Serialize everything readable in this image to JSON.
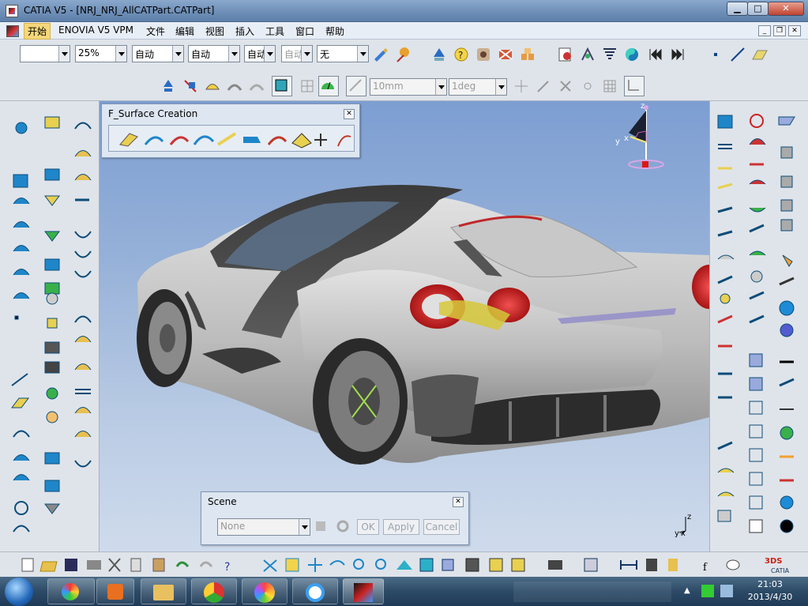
{
  "window": {
    "title": "CATIA V5 - [NRJ_NRJ_AllCATPart.CATPart]",
    "min_label": "▁",
    "max_label": "□",
    "close_label": "✕"
  },
  "menu": {
    "items": [
      "开始",
      "ENOVIA V5 VPM",
      "文件",
      "编辑",
      "视图",
      "插入",
      "工具",
      "窗口",
      "帮助"
    ]
  },
  "toolbar": {
    "combos": [
      "",
      "25%",
      "自动",
      "自动",
      "自动",
      "自动",
      "无"
    ],
    "length_value": "10mm",
    "angle_value": "1deg"
  },
  "surface_panel": {
    "title": "F_Surface Creation",
    "close": "✕"
  },
  "scene_panel": {
    "title": "Scene",
    "close": "✕",
    "select_value": "None",
    "ok": "OK",
    "apply": "Apply",
    "cancel": "Cancel"
  },
  "compass": {
    "x": "x",
    "y": "y",
    "z": "z"
  },
  "axis": {
    "x": "x",
    "y": "y",
    "z": "z"
  },
  "taskbar": {
    "time": "21:03",
    "date": "2013/4/30"
  },
  "colors": {
    "accent": "#6f90b8",
    "viewport_top": "#7d9ed2",
    "viewport_bottom": "#cfdbec",
    "start_highlight": "#f5d77a"
  },
  "icons": [
    "app-icon",
    "start-orb-icon",
    "media-icon",
    "explorer-icon",
    "chrome-icon",
    "picasa-icon",
    "ie-icon",
    "catia-icon",
    "compass-icon",
    "dassault-logo-icon"
  ]
}
